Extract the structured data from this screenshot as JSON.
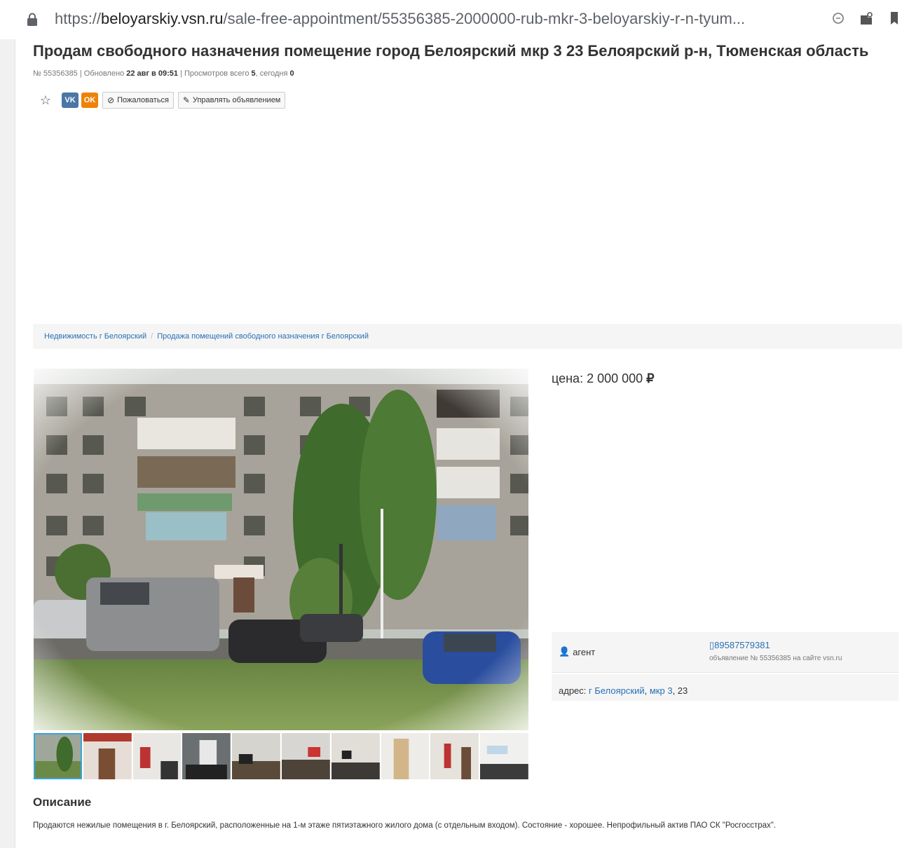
{
  "browser": {
    "url_prefix": "https://",
    "url_host": "beloyarskiy.vsn.ru",
    "url_path": "/sale-free-appointment/55356385-2000000-rub-mkr-3-beloyarskiy-r-n-tyum..."
  },
  "listing": {
    "title": "Продам свободного назначения помещение город Белоярский мкр 3 23 Белоярский р-н, Тюменская область",
    "meta_number": "№ 55356385",
    "meta_sep1": " | Обновлено ",
    "meta_updated": "22 авг в 09:51",
    "meta_sep2": " | Просмотров всего ",
    "meta_views_total": "5",
    "meta_sep3": ", сегодня ",
    "meta_views_today": "0"
  },
  "actions": {
    "vk_label": "VK",
    "ok_label": "OK",
    "complain_label": "Пожаловаться",
    "manage_label": "Управлять объявлением"
  },
  "breadcrumbs": [
    {
      "label": "Недвижимость г Белоярский"
    },
    {
      "label": "Продажа помещений свободного назначения г Белоярский"
    }
  ],
  "price": {
    "label": "цена: ",
    "value": "2 000 000",
    "currency": "₽"
  },
  "contact": {
    "role": "агент",
    "phone": "89587579381",
    "ad_note": "объявление № 55356385 на сайте vsn.ru"
  },
  "address": {
    "label": "адрес: ",
    "city": "г Белоярский",
    "comma1": ", ",
    "district": "мкр 3",
    "comma2": ", ",
    "house": "23"
  },
  "gallery": {
    "thumb_count": 10,
    "active_index": 0
  },
  "description": {
    "heading": "Описание",
    "text": "Продаются нежилые помещения в г. Белоярский, расположенные на 1-м этаже пятиэтажного жилого дома (с отдельным входом). Состояние - хорошее. Непрофильный актив ПАО СК \"Росгосстрах\"."
  },
  "icons": {
    "lock": "lock-icon",
    "star": "star-icon",
    "ban": "ban-icon",
    "edit": "edit-icon",
    "person": "person-icon",
    "phone": "phone-icon"
  }
}
